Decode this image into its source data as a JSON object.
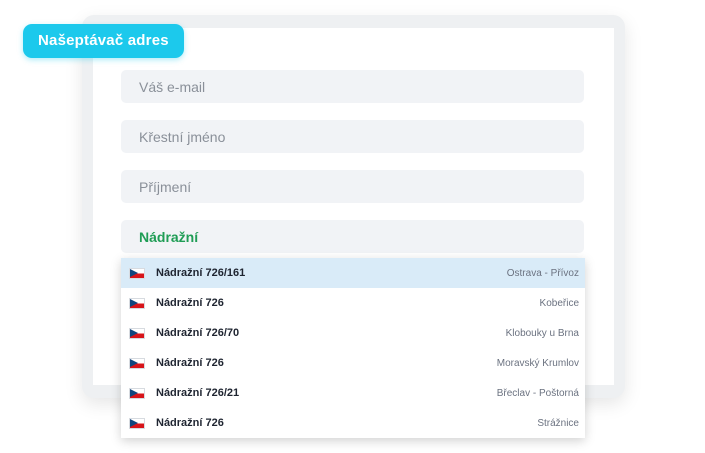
{
  "badge": {
    "label": "Našeptávač adres",
    "color": "#1cc9ec"
  },
  "form": {
    "email_placeholder": "Váš e-mail",
    "firstname_placeholder": "Křestní jméno",
    "lastname_placeholder": "Příjmení",
    "street_value": "Nádražní"
  },
  "suggestions": [
    {
      "street": "Nádražní 726/161",
      "city": "Ostrava - Přívoz",
      "flag": "czech-flag-icon"
    },
    {
      "street": "Nádražní 726",
      "city": "Kobeřice",
      "flag": "czech-flag-icon"
    },
    {
      "street": "Nádražní 726/70",
      "city": "Klobouky u Brna",
      "flag": "czech-flag-icon"
    },
    {
      "street": "Nádražní 726",
      "city": "Moravský Krumlov",
      "flag": "czech-flag-icon"
    },
    {
      "street": "Nádražní 726/21",
      "city": "Břeclav - Poštorná",
      "flag": "czech-flag-icon"
    },
    {
      "street": "Nádražní 726",
      "city": "Strážnice",
      "flag": "czech-flag-icon"
    }
  ],
  "colors": {
    "accent": "#1cc9ec",
    "input_text_active": "#1f9d55",
    "highlight_row": "#d9ebf8"
  }
}
